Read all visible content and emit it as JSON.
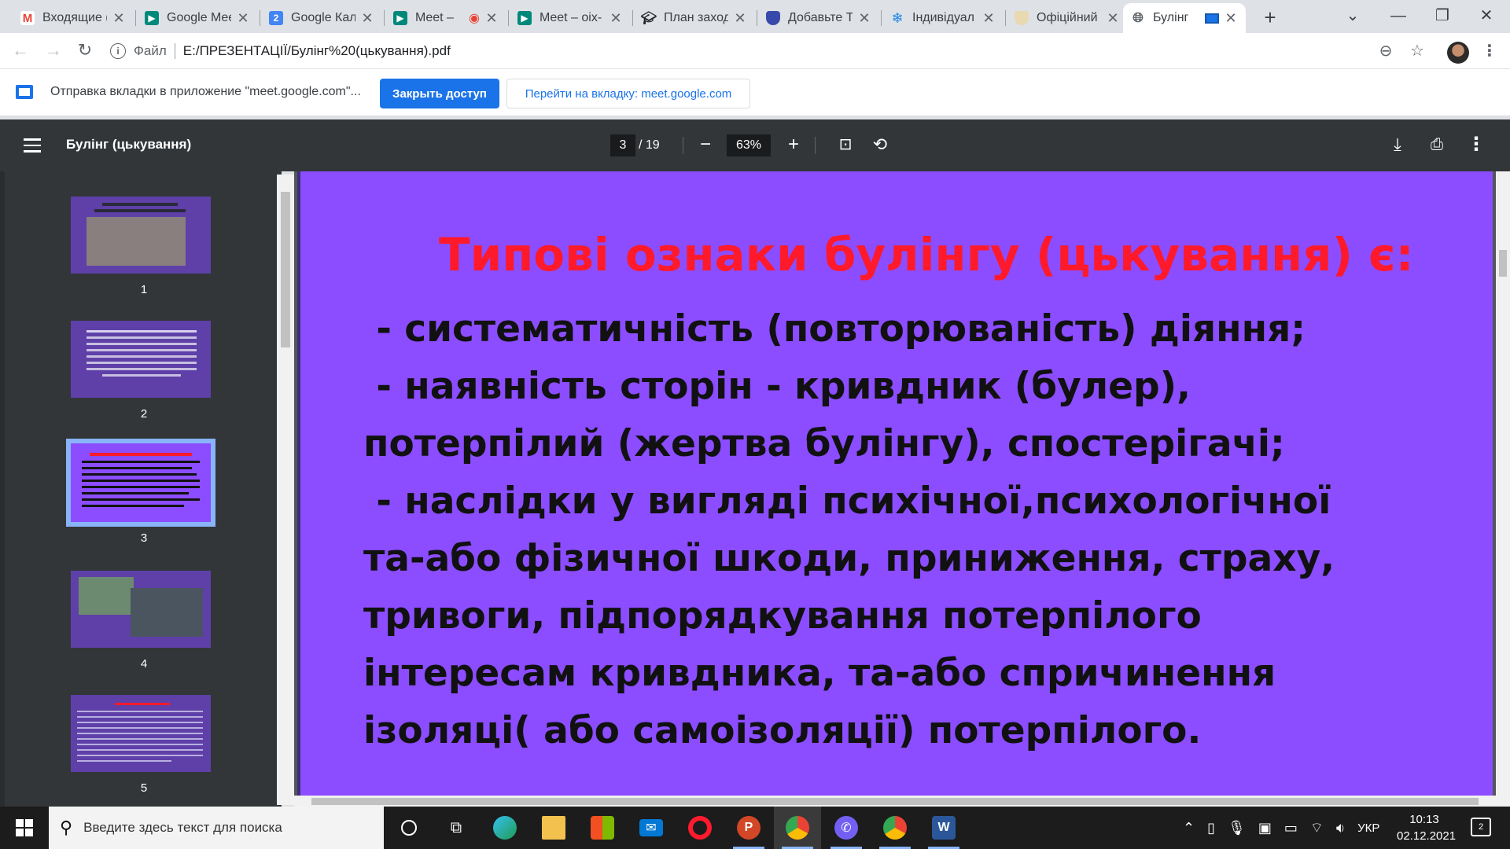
{
  "tabs": [
    {
      "title": "Входящие (",
      "favicon": "gmail-icon",
      "color": "#ea4335"
    },
    {
      "title": "Google Meet",
      "favicon": "meet-icon",
      "color": "#00897b"
    },
    {
      "title": "Google Кал",
      "favicon": "calendar-icon",
      "color": "#4285f4"
    },
    {
      "title": "Meet –",
      "favicon": "meet-icon",
      "color": "#00897b"
    },
    {
      "title": "Meet – oix-",
      "favicon": "meet-icon",
      "color": "#00897b"
    },
    {
      "title": "План заход",
      "favicon": "mortarboard-icon",
      "color": "#202124"
    },
    {
      "title": "Добавьте Т",
      "favicon": "shield-icon",
      "color": "#3949ab"
    },
    {
      "title": "Індивідуал",
      "favicon": "snowflake-icon",
      "color": "#1e88e5"
    },
    {
      "title": "Офіційний",
      "favicon": "crest-icon",
      "color": "#b08d57"
    },
    {
      "title": "Булінг",
      "favicon": "globe-icon",
      "color": "#5f6368"
    }
  ],
  "address": {
    "scheme": "Файл",
    "url": "E:/ПРЕЗЕНТАЦІЇ/Булінг%20(цькування).pdf"
  },
  "infobar": {
    "text": "Отправка вкладки в приложение \"meet.google.com\"...",
    "close_access": "Закрыть доступ",
    "goto_tab": "Перейти на вкладку: meet.google.com"
  },
  "pdf": {
    "title": "Булінг (цькування)",
    "current_page": "3",
    "total_pages": "/ 19",
    "zoom": "63%",
    "thumbnails": [
      "1",
      "2",
      "3",
      "4",
      "5"
    ],
    "selected_page": 3
  },
  "slide": {
    "title": "Типові ознаки булінгу (цькування) є:",
    "body": " - систематичність (повторюваність) діяння;\n - наявність сторін - кривдник (булер),\nпотерпілий (жертва булінгу), спостерігачі;\n - наслідки у вигляді психічної,психологічної\nта-або фізичної шкоди, приниження, страху,\nтривоги, підпорядкування потерпілого\nінтересам кривдника, та-або спричинення\nізоляці( або самоізоляції) потерпілого."
  },
  "taskbar": {
    "search_placeholder": "Введите здесь текст для поиска",
    "language": "УКР",
    "time": "10:13",
    "date": "02.12.2021",
    "notifications": "2"
  },
  "colors": {
    "slide_bg": "#8b4dff",
    "slide_title": "#ff1a2b",
    "accent": "#1a73e8"
  }
}
